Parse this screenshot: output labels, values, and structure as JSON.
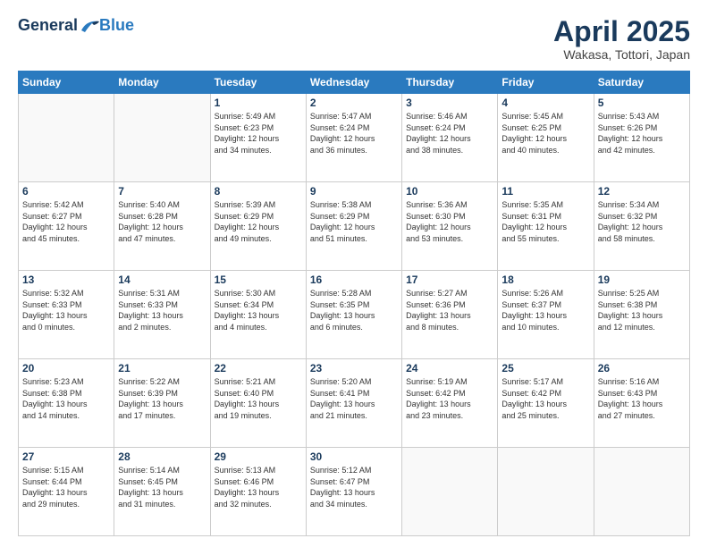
{
  "logo": {
    "general": "General",
    "blue": "Blue"
  },
  "title": "April 2025",
  "location": "Wakasa, Tottori, Japan",
  "days_header": [
    "Sunday",
    "Monday",
    "Tuesday",
    "Wednesday",
    "Thursday",
    "Friday",
    "Saturday"
  ],
  "weeks": [
    [
      {
        "day": "",
        "info": ""
      },
      {
        "day": "",
        "info": ""
      },
      {
        "day": "1",
        "info": "Sunrise: 5:49 AM\nSunset: 6:23 PM\nDaylight: 12 hours\nand 34 minutes."
      },
      {
        "day": "2",
        "info": "Sunrise: 5:47 AM\nSunset: 6:24 PM\nDaylight: 12 hours\nand 36 minutes."
      },
      {
        "day": "3",
        "info": "Sunrise: 5:46 AM\nSunset: 6:24 PM\nDaylight: 12 hours\nand 38 minutes."
      },
      {
        "day": "4",
        "info": "Sunrise: 5:45 AM\nSunset: 6:25 PM\nDaylight: 12 hours\nand 40 minutes."
      },
      {
        "day": "5",
        "info": "Sunrise: 5:43 AM\nSunset: 6:26 PM\nDaylight: 12 hours\nand 42 minutes."
      }
    ],
    [
      {
        "day": "6",
        "info": "Sunrise: 5:42 AM\nSunset: 6:27 PM\nDaylight: 12 hours\nand 45 minutes."
      },
      {
        "day": "7",
        "info": "Sunrise: 5:40 AM\nSunset: 6:28 PM\nDaylight: 12 hours\nand 47 minutes."
      },
      {
        "day": "8",
        "info": "Sunrise: 5:39 AM\nSunset: 6:29 PM\nDaylight: 12 hours\nand 49 minutes."
      },
      {
        "day": "9",
        "info": "Sunrise: 5:38 AM\nSunset: 6:29 PM\nDaylight: 12 hours\nand 51 minutes."
      },
      {
        "day": "10",
        "info": "Sunrise: 5:36 AM\nSunset: 6:30 PM\nDaylight: 12 hours\nand 53 minutes."
      },
      {
        "day": "11",
        "info": "Sunrise: 5:35 AM\nSunset: 6:31 PM\nDaylight: 12 hours\nand 55 minutes."
      },
      {
        "day": "12",
        "info": "Sunrise: 5:34 AM\nSunset: 6:32 PM\nDaylight: 12 hours\nand 58 minutes."
      }
    ],
    [
      {
        "day": "13",
        "info": "Sunrise: 5:32 AM\nSunset: 6:33 PM\nDaylight: 13 hours\nand 0 minutes."
      },
      {
        "day": "14",
        "info": "Sunrise: 5:31 AM\nSunset: 6:33 PM\nDaylight: 13 hours\nand 2 minutes."
      },
      {
        "day": "15",
        "info": "Sunrise: 5:30 AM\nSunset: 6:34 PM\nDaylight: 13 hours\nand 4 minutes."
      },
      {
        "day": "16",
        "info": "Sunrise: 5:28 AM\nSunset: 6:35 PM\nDaylight: 13 hours\nand 6 minutes."
      },
      {
        "day": "17",
        "info": "Sunrise: 5:27 AM\nSunset: 6:36 PM\nDaylight: 13 hours\nand 8 minutes."
      },
      {
        "day": "18",
        "info": "Sunrise: 5:26 AM\nSunset: 6:37 PM\nDaylight: 13 hours\nand 10 minutes."
      },
      {
        "day": "19",
        "info": "Sunrise: 5:25 AM\nSunset: 6:38 PM\nDaylight: 13 hours\nand 12 minutes."
      }
    ],
    [
      {
        "day": "20",
        "info": "Sunrise: 5:23 AM\nSunset: 6:38 PM\nDaylight: 13 hours\nand 14 minutes."
      },
      {
        "day": "21",
        "info": "Sunrise: 5:22 AM\nSunset: 6:39 PM\nDaylight: 13 hours\nand 17 minutes."
      },
      {
        "day": "22",
        "info": "Sunrise: 5:21 AM\nSunset: 6:40 PM\nDaylight: 13 hours\nand 19 minutes."
      },
      {
        "day": "23",
        "info": "Sunrise: 5:20 AM\nSunset: 6:41 PM\nDaylight: 13 hours\nand 21 minutes."
      },
      {
        "day": "24",
        "info": "Sunrise: 5:19 AM\nSunset: 6:42 PM\nDaylight: 13 hours\nand 23 minutes."
      },
      {
        "day": "25",
        "info": "Sunrise: 5:17 AM\nSunset: 6:42 PM\nDaylight: 13 hours\nand 25 minutes."
      },
      {
        "day": "26",
        "info": "Sunrise: 5:16 AM\nSunset: 6:43 PM\nDaylight: 13 hours\nand 27 minutes."
      }
    ],
    [
      {
        "day": "27",
        "info": "Sunrise: 5:15 AM\nSunset: 6:44 PM\nDaylight: 13 hours\nand 29 minutes."
      },
      {
        "day": "28",
        "info": "Sunrise: 5:14 AM\nSunset: 6:45 PM\nDaylight: 13 hours\nand 31 minutes."
      },
      {
        "day": "29",
        "info": "Sunrise: 5:13 AM\nSunset: 6:46 PM\nDaylight: 13 hours\nand 32 minutes."
      },
      {
        "day": "30",
        "info": "Sunrise: 5:12 AM\nSunset: 6:47 PM\nDaylight: 13 hours\nand 34 minutes."
      },
      {
        "day": "",
        "info": ""
      },
      {
        "day": "",
        "info": ""
      },
      {
        "day": "",
        "info": ""
      }
    ]
  ]
}
